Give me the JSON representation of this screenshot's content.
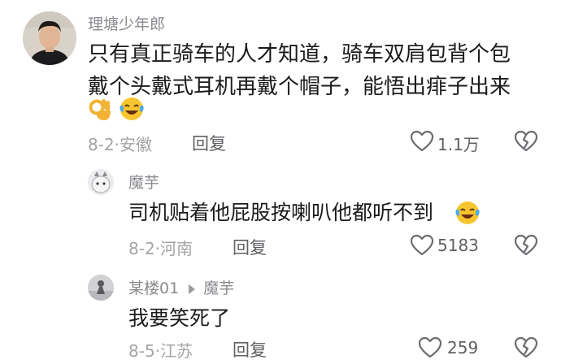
{
  "comments": [
    {
      "username": "理塘少年郎",
      "text_lines": [
        "只有真正骑车的人才知道，骑车双肩包背个包",
        "戴个头戴式耳机再戴个帽子，能悟出痱子出来"
      ],
      "emojis": [
        "ok-hand-emoji",
        "laughing-tears-emoji"
      ],
      "date": "8-2",
      "location": "安徽",
      "reply_label": "回复",
      "likes": "1.1万"
    },
    {
      "username": "魔芋",
      "text": "司机贴着他屁股按喇叭他都听不到",
      "emojis": [
        "laughing-tears-emoji"
      ],
      "date": "8-2",
      "location": "河南",
      "reply_label": "回复",
      "likes": "5183"
    },
    {
      "username": "某楼01",
      "reply_to": "魔芋",
      "text": "我要笑死了",
      "date": "8-5",
      "location": "江苏",
      "reply_label": "回复",
      "likes": "259"
    }
  ],
  "separator": "·",
  "icons": [
    "heart-icon",
    "broken-heart-icon",
    "reply-arrow-icon"
  ]
}
